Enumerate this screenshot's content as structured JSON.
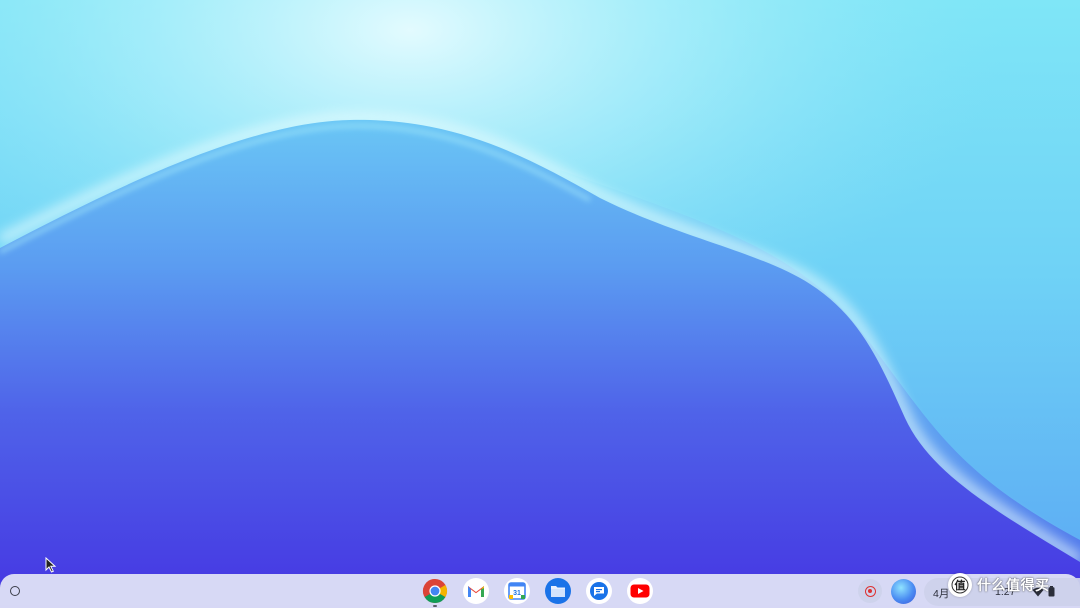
{
  "desktop": {
    "wallpaper_colors": [
      "#b9f3fb",
      "#5b8ef0",
      "#4737e3"
    ]
  },
  "shelf": {
    "launcher_icon": "launcher-circle-icon",
    "apps": [
      {
        "name": "Chrome",
        "icon": "chrome-icon"
      },
      {
        "name": "Gmail",
        "icon": "gmail-icon"
      },
      {
        "name": "Calendar",
        "icon": "calendar-icon",
        "day": "31"
      },
      {
        "name": "Files",
        "icon": "files-icon"
      },
      {
        "name": "Messages",
        "icon": "messages-icon"
      },
      {
        "name": "YouTube",
        "icon": "youtube-icon"
      }
    ],
    "tray": {
      "record_icon": "screen-record-icon",
      "date": "4月",
      "time": "1:27",
      "status_icons": [
        "wifi-icon",
        "battery-icon"
      ]
    }
  },
  "watermark": {
    "text": "什么值得买",
    "logo": "smzdm-logo"
  }
}
